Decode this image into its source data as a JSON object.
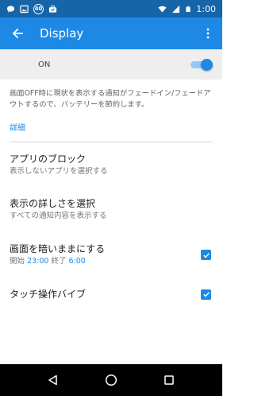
{
  "status_bar": {
    "time": "1:00",
    "notification_icons": [
      "chat-bubble-icon",
      "image-icon",
      "badge-40-icon",
      "briefcase-icon"
    ],
    "badge_text": "40",
    "system_icons": [
      "wifi-icon",
      "signal-icon",
      "battery-icon"
    ]
  },
  "app_bar": {
    "title": "Display"
  },
  "master_switch": {
    "label": "ON",
    "enabled": true
  },
  "description": "画面OFF時に現状を表示する通知がフェードイン/フェードアウトするので、バッテリーを節約します。",
  "details_link": "詳細",
  "preferences": [
    {
      "title": "アプリのブロック",
      "subtitle": "表示しないアプリを選択する"
    },
    {
      "title": "表示の詳しさを選択",
      "subtitle": "すべての通知内容を表示する"
    },
    {
      "title": "画面を暗いままにする",
      "subtitle_start_label": "開始",
      "subtitle_start_time": "23:00",
      "subtitle_end_label": "終了",
      "subtitle_end_time": "6:00",
      "checked": true
    },
    {
      "title": "タッチ操作バイブ",
      "checked": true
    }
  ],
  "colors": {
    "status_bar": "#1565a8",
    "app_bar": "#1e88e5",
    "accent": "#1e88e5",
    "switch_bar": "#eeeeee",
    "nav_bar": "#000000"
  }
}
